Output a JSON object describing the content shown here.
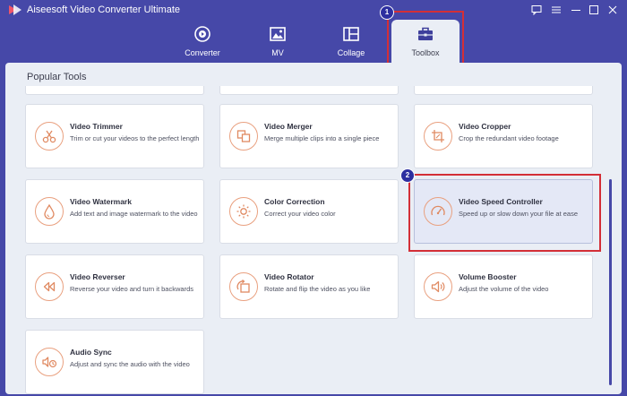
{
  "app": {
    "title": "Aiseesoft Video Converter Ultimate"
  },
  "window_controls": [
    {
      "name": "feedback-icon"
    },
    {
      "name": "menu-icon"
    },
    {
      "name": "minimize-icon"
    },
    {
      "name": "maximize-icon"
    },
    {
      "name": "close-icon"
    }
  ],
  "nav_tabs": [
    {
      "label": "Converter",
      "icon": "converter-icon"
    },
    {
      "label": "MV",
      "icon": "mv-icon"
    },
    {
      "label": "Collage",
      "icon": "collage-icon"
    },
    {
      "label": "Toolbox",
      "icon": "toolbox-icon",
      "active": true
    }
  ],
  "annotations": [
    {
      "number": "1",
      "target": "Toolbox"
    },
    {
      "number": "2",
      "target": "Video Speed Controller"
    }
  ],
  "colors": {
    "accent": "#4648a8",
    "annotation_red": "#d32f37",
    "icon_orange": "#e9a07f"
  },
  "section": {
    "title": "Popular Tools"
  },
  "tools": [
    {
      "title": "Video Trimmer",
      "desc": "Trim or cut your videos to the perfect length",
      "icon": "scissors-icon"
    },
    {
      "title": "Video Merger",
      "desc": "Merge multiple clips into a single piece",
      "icon": "merge-icon"
    },
    {
      "title": "Video Cropper",
      "desc": "Crop the redundant video footage",
      "icon": "crop-icon"
    },
    {
      "title": "Video Watermark",
      "desc": "Add text and image watermark to the video",
      "icon": "watermark-drop-icon"
    },
    {
      "title": "Color Correction",
      "desc": "Correct your video color",
      "icon": "sun-icon"
    },
    {
      "title": "Video Speed Controller",
      "desc": "Speed up or slow down your file at ease",
      "icon": "speedometer-icon",
      "selected": true
    },
    {
      "title": "Video Reverser",
      "desc": "Reverse your video and turn it backwards",
      "icon": "rewind-icon"
    },
    {
      "title": "Video Rotator",
      "desc": "Rotate and flip the video as you like",
      "icon": "rotate-icon"
    },
    {
      "title": "Volume Booster",
      "desc": "Adjust the volume of the video",
      "icon": "volume-icon"
    },
    {
      "title": "Audio Sync",
      "desc": "Adjust and sync the audio with the video",
      "icon": "audio-sync-icon"
    }
  ]
}
